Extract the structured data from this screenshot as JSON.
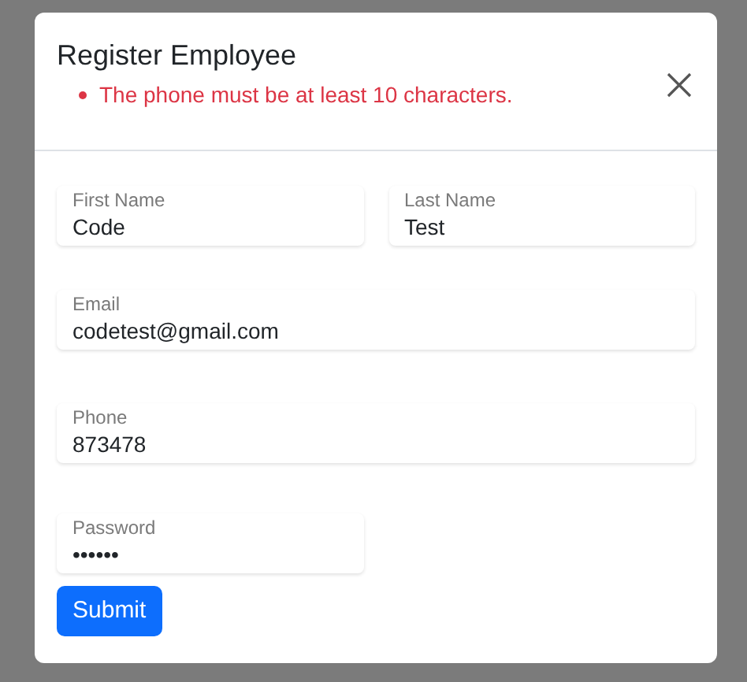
{
  "dialog": {
    "title": "Register Employee",
    "errors": [
      "The phone must be at least 10 characters."
    ]
  },
  "form": {
    "rows": [
      {
        "fields": [
          {
            "label": "First Name",
            "value": "Code",
            "wide": false
          },
          {
            "label": "Last Name",
            "value": "Test",
            "wide": false
          }
        ]
      },
      {
        "fields": [
          {
            "label": "Email",
            "value": "codetest@gmail.com",
            "wide": true
          }
        ]
      },
      {
        "fields": [
          {
            "label": "Phone",
            "value": "873478",
            "wide": true
          }
        ]
      },
      {
        "fields": [
          {
            "label": "Password",
            "value": "••••••",
            "wide": false
          }
        ]
      }
    ],
    "submit": "Submit"
  }
}
